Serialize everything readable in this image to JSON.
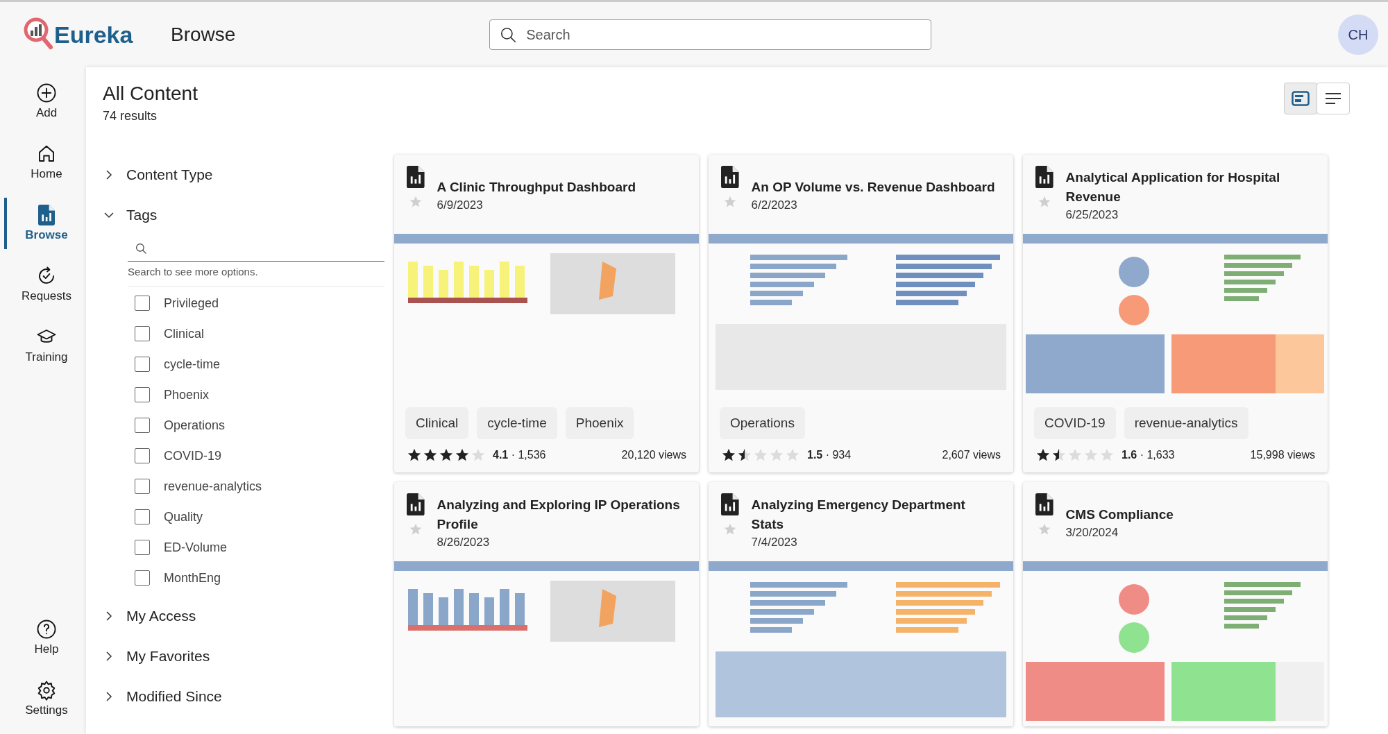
{
  "app": {
    "logo_text": "Eureka",
    "page_title": "Browse",
    "search": {
      "placeholder": "Search"
    },
    "avatar": "CH"
  },
  "nav": {
    "items": [
      {
        "label": "Add",
        "selected": false
      },
      {
        "label": "Home",
        "selected": false
      },
      {
        "label": "Browse",
        "selected": true
      },
      {
        "label": "Requests",
        "selected": false
      },
      {
        "label": "Training",
        "selected": false
      }
    ],
    "bottom_items": [
      {
        "label": "Help",
        "selected": false
      },
      {
        "label": "Settings",
        "selected": false
      }
    ]
  },
  "header": {
    "title": "All Content",
    "results": "74 results",
    "views": [
      {
        "kind": "cards",
        "selected": true
      },
      {
        "kind": "list",
        "selected": false
      }
    ]
  },
  "filters": [
    {
      "label": "Content Type",
      "expanded": false
    },
    {
      "label": "Tags",
      "expanded": true,
      "search": {
        "hint": "Search to see more options."
      },
      "options": [
        {
          "label": "Privileged",
          "checked": false
        },
        {
          "label": "Clinical",
          "checked": false
        },
        {
          "label": "cycle-time",
          "checked": false
        },
        {
          "label": "Phoenix",
          "checked": false
        },
        {
          "label": "Operations",
          "checked": false
        },
        {
          "label": "COVID-19",
          "checked": false
        },
        {
          "label": "revenue-analytics",
          "checked": false
        },
        {
          "label": "Quality",
          "checked": false
        },
        {
          "label": "ED-Volume",
          "checked": false
        },
        {
          "label": "MonthEng",
          "checked": false
        }
      ]
    },
    {
      "label": "My Access",
      "expanded": false
    },
    {
      "label": "My Favorites",
      "expanded": false
    },
    {
      "label": "Modified Since",
      "expanded": false
    }
  ],
  "cards": [
    {
      "title": "A Clinic Throughput Dashboard",
      "date": "6/9/2023",
      "favorite": false,
      "thumbnail": {
        "kind": "picture"
      },
      "tags": [
        "Clinical",
        "cycle-time",
        "Phoenix"
      ],
      "stars": 4,
      "rating": "**4.1** · 1,536",
      "views": "20,120 views"
    },
    {
      "title": "An OP Volume vs. Revenue Dashboard",
      "date": "6/2/2023",
      "favorite": false,
      "thumbnail": {
        "kind": "picture"
      },
      "tags": [
        "Operations"
      ],
      "stars": 1.5,
      "rating": "**1.5** · 934",
      "views": "2,607 views"
    },
    {
      "title": "Analytical Application for Hospital Revenue",
      "date": "6/25/2023",
      "favorite": false,
      "thumbnail": {
        "kind": "picture"
      },
      "tags": [
        "COVID-19",
        "revenue-analytics"
      ],
      "stars": 1.5,
      "rating": "**1.6** · 1,633",
      "views": "15,998 views"
    },
    {
      "title": "Analyzing and Exploring IP Operations Profile",
      "date": "8/26/2023",
      "favorite": false,
      "thumbnail": {
        "kind": "picture"
      }
    },
    {
      "title": "Analyzing Emergency Department Stats",
      "date": "7/4/2023",
      "favorite": false,
      "thumbnail": {
        "kind": "picture"
      }
    },
    {
      "title": "CMS Compliance",
      "date": "3/20/2024",
      "favorite": false,
      "thumbnail": {
        "kind": "picture"
      }
    }
  ]
}
